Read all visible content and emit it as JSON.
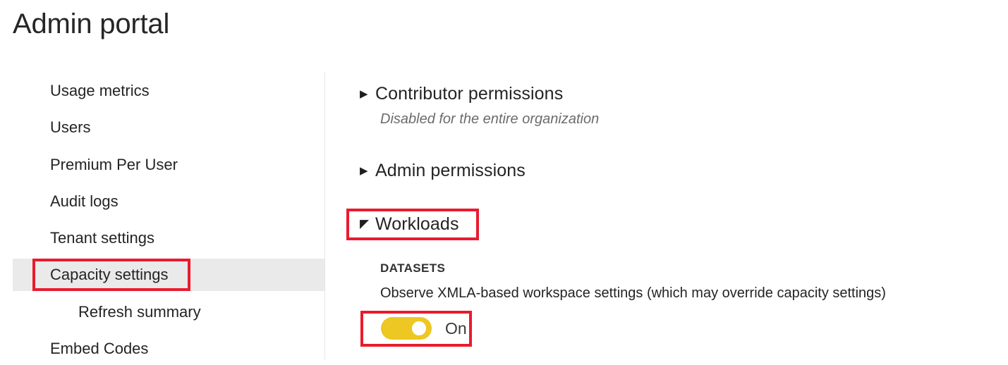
{
  "page": {
    "title": "Admin portal"
  },
  "sidebar": {
    "items": [
      {
        "label": "Usage metrics",
        "level": 0,
        "selected": false
      },
      {
        "label": "Users",
        "level": 0,
        "selected": false
      },
      {
        "label": "Premium Per User",
        "level": 0,
        "selected": false
      },
      {
        "label": "Audit logs",
        "level": 0,
        "selected": false
      },
      {
        "label": "Tenant settings",
        "level": 0,
        "selected": false
      },
      {
        "label": "Capacity settings",
        "level": 0,
        "selected": true
      },
      {
        "label": "Refresh summary",
        "level": 1,
        "selected": false
      },
      {
        "label": "Embed Codes",
        "level": 0,
        "selected": false
      }
    ]
  },
  "content": {
    "sections": [
      {
        "title": "Contributor permissions",
        "expanded": false,
        "chevron_icon": "chevron-right-icon",
        "subtitle": "Disabled for the entire organization"
      },
      {
        "title": "Admin permissions",
        "expanded": false,
        "chevron_icon": "chevron-right-icon",
        "subtitle": ""
      },
      {
        "title": "Workloads",
        "expanded": true,
        "chevron_icon": "chevron-expanded-icon",
        "subtitle": ""
      }
    ],
    "workloads": {
      "group_label": "DATASETS",
      "setting_description": "Observe XMLA-based workspace settings (which may override capacity settings)",
      "toggle": {
        "state_label": "On",
        "on": true
      }
    }
  },
  "icons": {
    "chevron_right": "▶",
    "chevron_expanded": "◤"
  },
  "colors": {
    "accent_toggle": "#EDC722",
    "annotation_red": "#EA1B2D",
    "selected_row": "#EAEAEA",
    "divider": "#E6E6E6",
    "text_primary": "#252423",
    "text_muted": "#6B6B6B"
  },
  "annotations": [
    {
      "target": "sidebar-item-capacity-settings"
    },
    {
      "target": "section-workloads"
    },
    {
      "target": "xmla-toggle"
    }
  ]
}
